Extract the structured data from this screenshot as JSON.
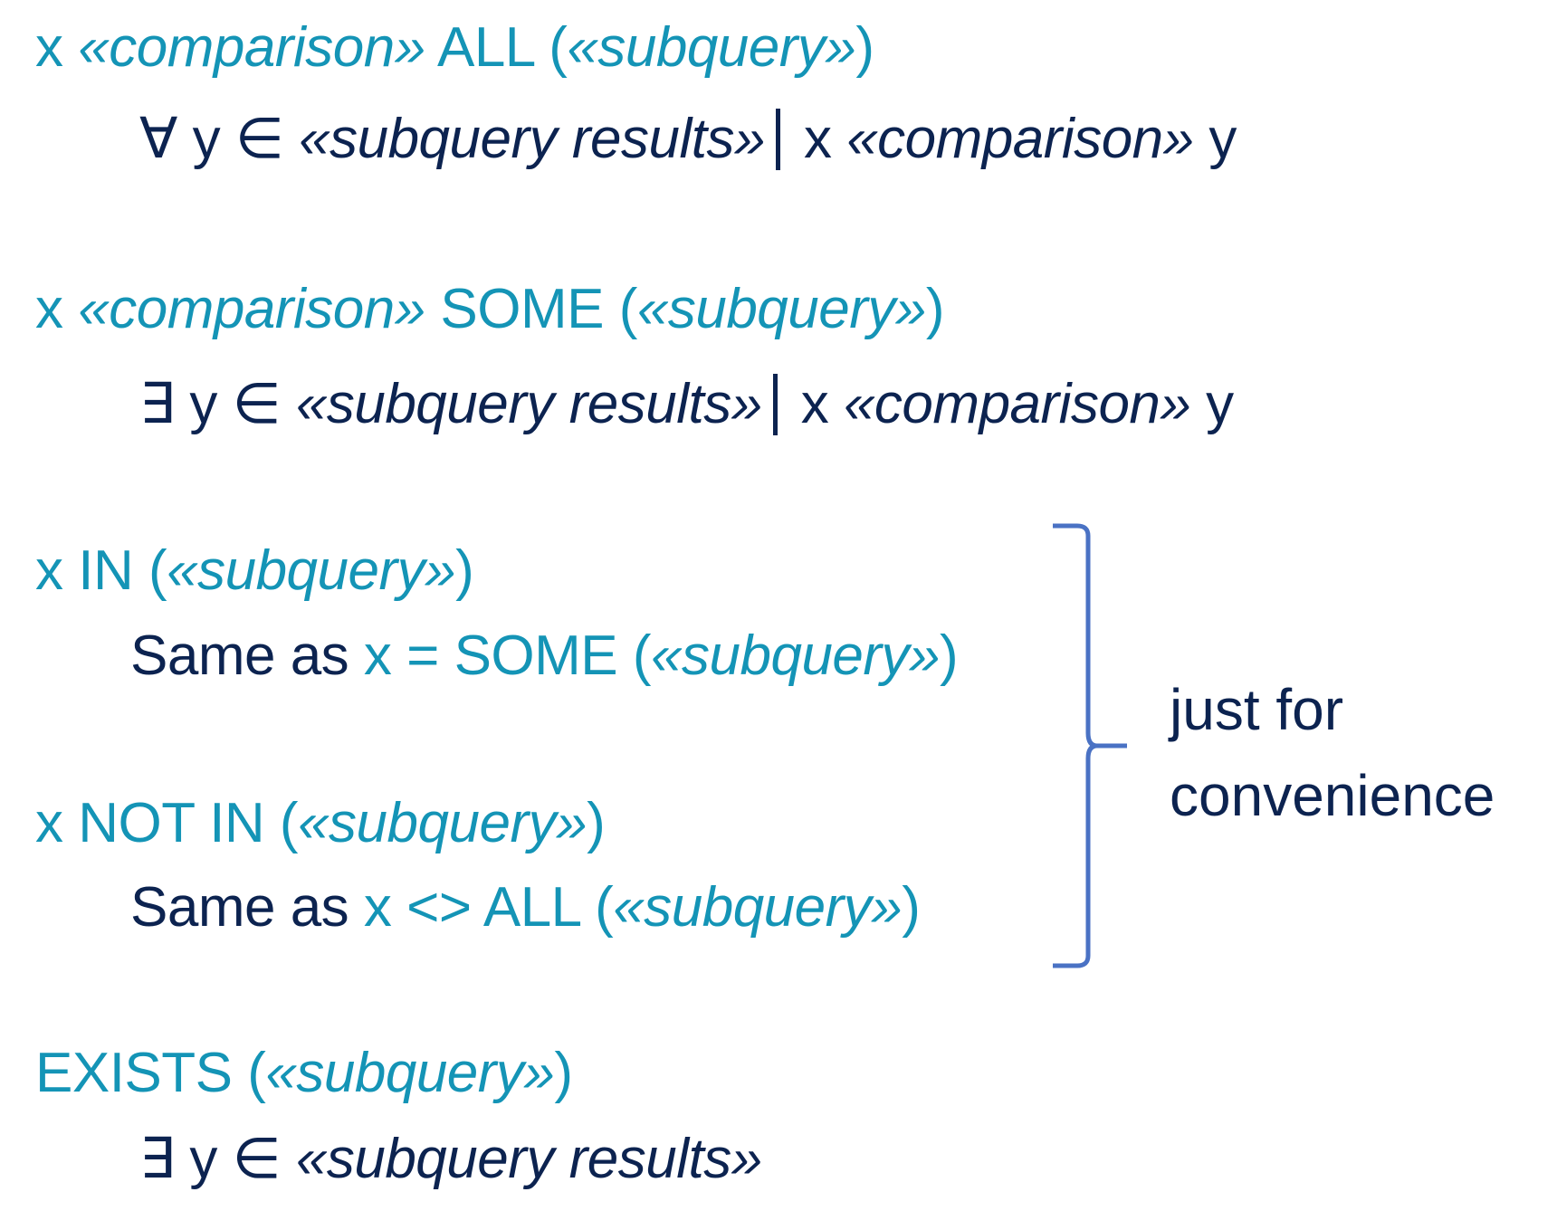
{
  "colors": {
    "teal": "#1494b6",
    "navy": "#0c2350",
    "brace": "#4a72c4"
  },
  "all": {
    "syntax": [
      "x ",
      "«comparison»",
      " ALL (",
      "«subquery»",
      ")"
    ],
    "meaning": [
      "∀ y ∈ ",
      "«subquery results»",
      "x ",
      "«comparison»",
      " y"
    ]
  },
  "some": {
    "syntax": [
      "x ",
      "«comparison»",
      " SOME (",
      "«subquery»",
      ")"
    ],
    "meaning": [
      "∃ y ∈ ",
      "«subquery results»",
      "x ",
      "«comparison»",
      " y"
    ]
  },
  "in": {
    "syntax": [
      "x IN (",
      "«subquery»",
      ")"
    ],
    "meaning": [
      "Same as ",
      "x = SOME (",
      "«subquery»",
      ")"
    ]
  },
  "not_in": {
    "syntax": [
      "x NOT IN (",
      "«subquery»",
      ")"
    ],
    "meaning": [
      "Same as ",
      "x <> ALL (",
      "«subquery»",
      ")"
    ]
  },
  "exists": {
    "syntax": [
      "EXISTS (",
      "«subquery»",
      ")"
    ],
    "meaning": [
      "∃ y ∈ ",
      "«subquery results»"
    ]
  },
  "annotation": {
    "line1": "just for",
    "line2": "convenience"
  }
}
